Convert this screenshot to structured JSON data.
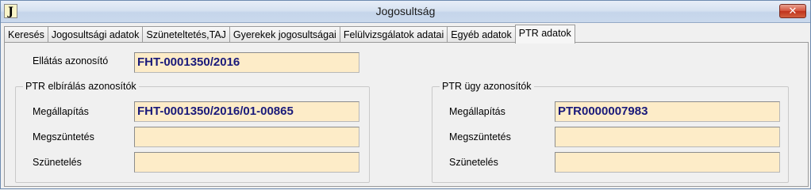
{
  "window": {
    "title": "Jogosultság",
    "icon_letter": "J",
    "close_glyph": "✕"
  },
  "tabs": [
    {
      "label": "Keresés",
      "active": false
    },
    {
      "label": "Jogosultsági adatok",
      "active": false
    },
    {
      "label": "Szüneteltetés,TAJ",
      "active": false
    },
    {
      "label": "Gyerekek jogosultságai",
      "active": false
    },
    {
      "label": "Felülvizsgálatok adatai",
      "active": false
    },
    {
      "label": "Egyéb adatok",
      "active": false
    },
    {
      "label": "PTR adatok",
      "active": true
    }
  ],
  "ellatas": {
    "label": "Ellátás azonosító",
    "value": "FHT-0001350/2016"
  },
  "elbiralas": {
    "legend": "PTR elbírálás azonosítók",
    "megallapitas_label": "Megállapítás",
    "megallapitas_value": "FHT-0001350/2016/01-00865",
    "megszuntetes_label": "Megszüntetés",
    "megszuntetes_value": "",
    "szuneteles_label": "Szünetelés",
    "szuneteles_value": ""
  },
  "ugy": {
    "legend": "PTR ügy azonosítók",
    "megallapitas_label": "Megállapítás",
    "megallapitas_value": "PTR0000007983",
    "megszuntetes_label": "Megszüntetés",
    "megszuntetes_value": "",
    "szuneteles_label": "Szünetelés",
    "szuneteles_value": ""
  },
  "colors": {
    "field_bg": "#fdecc8",
    "field_text": "#1a1a7a",
    "close_red": "#c0331c"
  }
}
